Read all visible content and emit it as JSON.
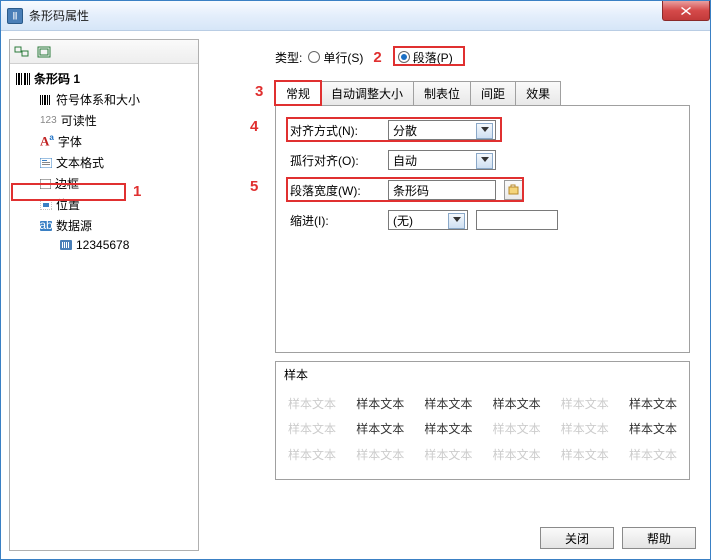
{
  "title": "条形码属性",
  "tree": {
    "root": "条形码 1",
    "items": [
      "符号体系和大小",
      "可读性",
      "字体",
      "文本格式",
      "边框",
      "位置",
      "数据源"
    ],
    "datasource_value": "12345678"
  },
  "typeRow": {
    "label": "类型:",
    "single": "单行(S)",
    "para": "段落(P)"
  },
  "tabs": [
    "常规",
    "自动调整大小",
    "制表位",
    "间距",
    "效果"
  ],
  "fields": {
    "align_label": "对齐方式(N):",
    "align_value": "分散",
    "orphan_label": "孤行对齐(O):",
    "orphan_value": "自动",
    "width_label": "段落宽度(W):",
    "width_value": "条形码",
    "indent_label": "缩进(I):",
    "indent_value": "(无)"
  },
  "sample": {
    "label": "样本",
    "token": "样本文本"
  },
  "annotations": {
    "n1": "1",
    "n2": "2",
    "n3": "3",
    "n4": "4",
    "n5": "5"
  },
  "footer": {
    "close": "关闭",
    "help": "帮助"
  }
}
